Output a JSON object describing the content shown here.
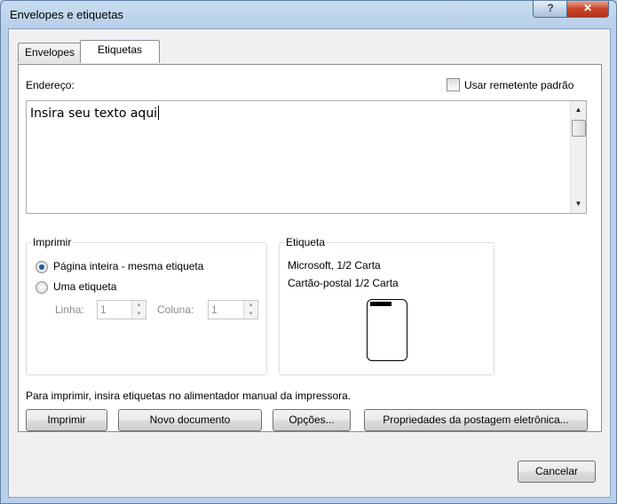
{
  "window": {
    "title": "Envelopes e etiquetas",
    "help_label": "?",
    "close_label": "✕"
  },
  "tabs": [
    {
      "label": "Envelopes",
      "active": false
    },
    {
      "label": "Etiquetas",
      "active": true
    }
  ],
  "address": {
    "label": "Endereço:",
    "text": "Insira seu texto aqui",
    "use_return_address_label": "Usar remetente padrão",
    "use_return_address_checked": false
  },
  "print_group": {
    "title": "Imprimir",
    "full_page_label": "Página inteira - mesma etiqueta",
    "single_label": "Uma etiqueta",
    "selected": "full_page",
    "row_label": "Linha:",
    "row_value": "1",
    "column_label": "Coluna:",
    "column_value": "1"
  },
  "label_group": {
    "title": "Etiqueta",
    "line1": "Microsoft, 1/2 Carta",
    "line2": "Cartão-postal 1/2 Carta"
  },
  "instruction": "Para imprimir, insira etiquetas no alimentador manual da impressora.",
  "buttons": {
    "print": "Imprimir",
    "new_document": "Novo documento",
    "options": "Opções...",
    "epostage": "Propriedades da postagem eletrônica...",
    "cancel": "Cancelar"
  },
  "icons": {
    "scroll_up": "▲",
    "scroll_down": "▼",
    "spin_up": "▲",
    "spin_down": "▼"
  }
}
